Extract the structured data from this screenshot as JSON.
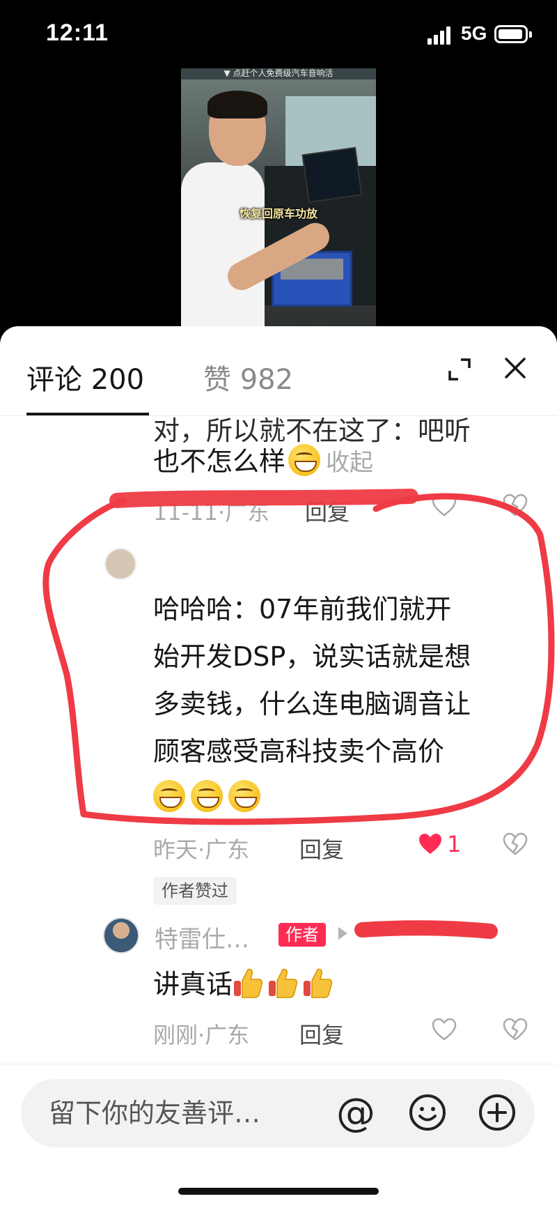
{
  "status_bar": {
    "time": "12:11",
    "network": "5G"
  },
  "video": {
    "top_text": "▼ 点赶个人免费级汽车音响活",
    "caption": "恢复回原车功放"
  },
  "tabs": {
    "comments": "评论 200",
    "likes": "赞 982"
  },
  "comments": [
    {
      "text_partial": "对，所以就不在这了：吧听",
      "text": "也不怎么样",
      "collapse_label": "收起",
      "meta": "11-11·广东",
      "reply_label": "回复"
    },
    {
      "text": "哈哈哈：07年前我们就开始开发DSP，说实话就是想多卖钱，什么连电脑调音让顾客感受高科技卖个高价",
      "lines": [
        "哈哈哈：07年前我们就开",
        "始开发DSP，说实话就是想",
        "多卖钱，什么连电脑调音让",
        "顾客感受高科技卖个高价"
      ],
      "meta": "昨天·广东",
      "reply_label": "回复",
      "likes": "1",
      "author_liked": "作者赞过"
    }
  ],
  "reply": {
    "name": "特雷仕…",
    "badge": "作者",
    "text": "讲真话",
    "meta": "刚刚·广东",
    "reply_label": "回复"
  },
  "composer": {
    "placeholder": "留下你的友善评…",
    "at_symbol": "@"
  },
  "colors": {
    "accent": "#fe2c55",
    "annotation": "#ee3b45"
  }
}
